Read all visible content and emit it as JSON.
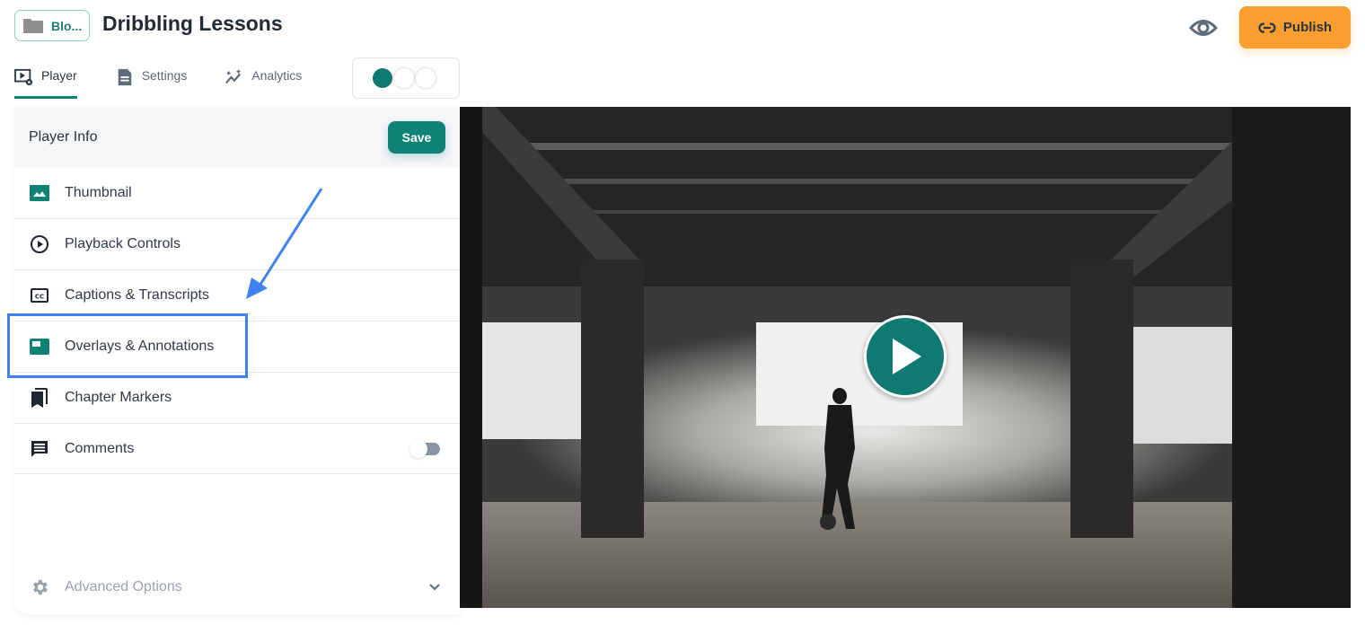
{
  "header": {
    "folder_label": "Blo...",
    "title": "Dribbling Lessons",
    "publish_label": "Publish"
  },
  "tabs": [
    {
      "label": "Player",
      "active": true
    },
    {
      "label": "Settings",
      "active": false
    },
    {
      "label": "Analytics",
      "active": false
    }
  ],
  "theme_toggle": {
    "selected_index": 0,
    "options": 3
  },
  "panel": {
    "title": "Player Info",
    "save_label": "Save",
    "items": [
      {
        "label": "Thumbnail",
        "icon": "image-icon"
      },
      {
        "label": "Playback Controls",
        "icon": "play-circle-icon"
      },
      {
        "label": "Captions & Transcripts",
        "icon": "closed-captions-icon"
      },
      {
        "label": "Overlays & Annotations",
        "icon": "overlay-icon"
      },
      {
        "label": "Chapter Markers",
        "icon": "bookmarks-icon"
      },
      {
        "label": "Comments",
        "icon": "comment-icon",
        "toggle": false
      }
    ],
    "advanced_label": "Advanced Options"
  },
  "colors": {
    "brand": "#0f8276",
    "publish": "#fb9f31",
    "annotation": "#3e82f1"
  },
  "video": {
    "play_icon": "play-icon"
  }
}
